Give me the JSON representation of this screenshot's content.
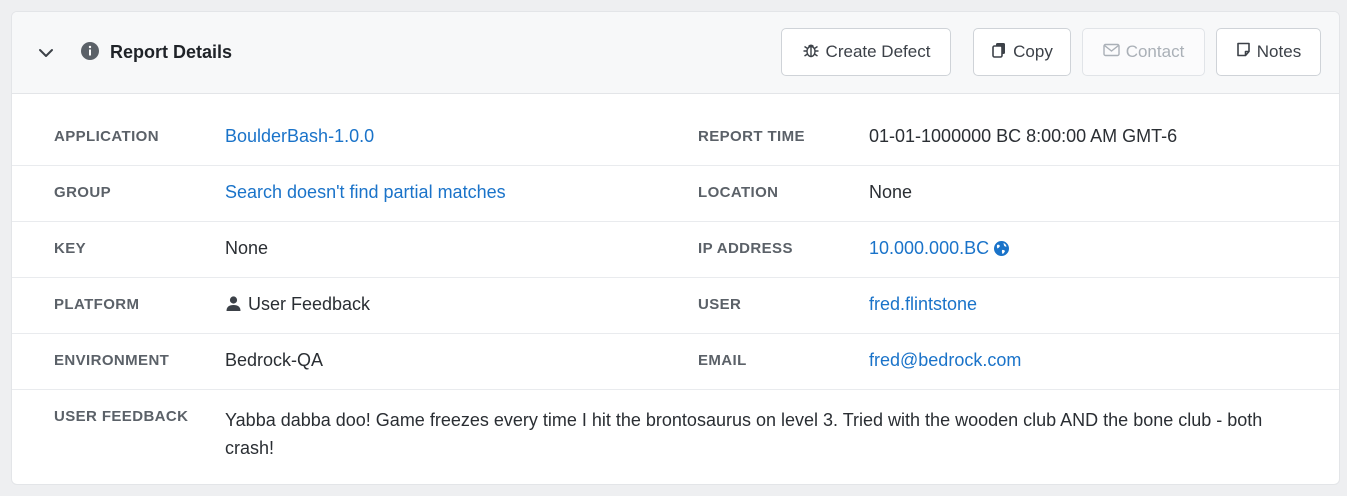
{
  "header": {
    "title": "Report Details",
    "buttons": {
      "create_defect": "Create Defect",
      "copy": "Copy",
      "contact": "Contact",
      "notes": "Notes"
    }
  },
  "details": {
    "application": {
      "label": "APPLICATION",
      "value": "BoulderBash-1.0.0"
    },
    "report_time": {
      "label": "REPORT TIME",
      "value": "01-01-1000000 BC 8:00:00 AM GMT-6"
    },
    "group": {
      "label": "GROUP",
      "value": "Search doesn't find partial matches"
    },
    "location": {
      "label": "LOCATION",
      "value": "None"
    },
    "key": {
      "label": "KEY",
      "value": "None"
    },
    "ip_address": {
      "label": "IP ADDRESS",
      "value": "10.000.000.BC"
    },
    "platform": {
      "label": "PLATFORM",
      "value": "User Feedback"
    },
    "user": {
      "label": "USER",
      "value": "fred.flintstone"
    },
    "environment": {
      "label": "ENVIRONMENT",
      "value": "Bedrock-QA"
    },
    "email": {
      "label": "EMAIL",
      "value": "fred@bedrock.com"
    },
    "user_feedback": {
      "label": "USER FEEDBACK",
      "value": "Yabba dabba doo! Game freezes every time I hit the brontosaurus on level 3. Tried with the wooden club AND the bone club - both crash!"
    }
  },
  "colors": {
    "link": "#1a73c9",
    "label": "#5b6168"
  },
  "icons": [
    "chevron-down-icon",
    "info-icon",
    "bug-icon",
    "copy-icon",
    "mail-icon",
    "note-icon",
    "user-icon",
    "globe-icon"
  ]
}
